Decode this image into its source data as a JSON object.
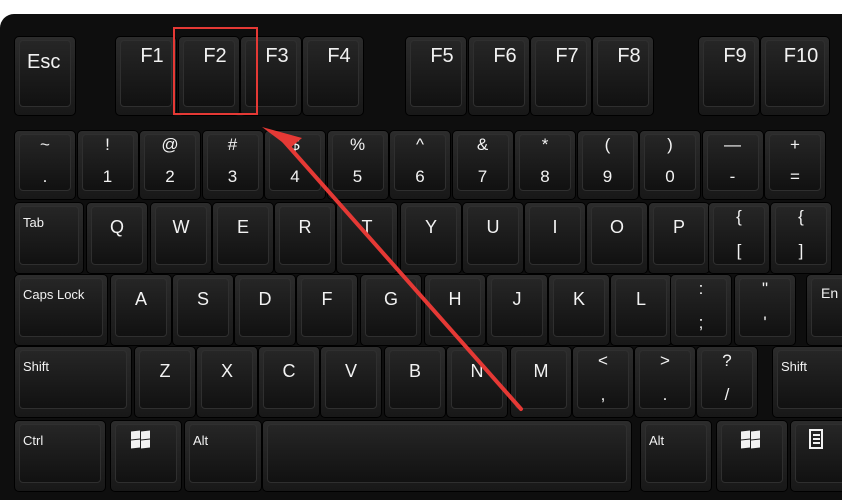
{
  "keyboard": {
    "function_row": [
      "Esc",
      "F1",
      "F2",
      "F3",
      "F4",
      "F5",
      "F6",
      "F7",
      "F8",
      "F9",
      "F10"
    ],
    "number_row": [
      {
        "top": "~",
        "bottom": "."
      },
      {
        "top": "!",
        "bottom": "1"
      },
      {
        "top": "@",
        "bottom": "2"
      },
      {
        "top": "#",
        "bottom": "3"
      },
      {
        "top": "$",
        "bottom": "4"
      },
      {
        "top": "%",
        "bottom": "5"
      },
      {
        "top": "^",
        "bottom": "6"
      },
      {
        "top": "&",
        "bottom": "7"
      },
      {
        "top": "*",
        "bottom": "8"
      },
      {
        "top": "(",
        "bottom": "9"
      },
      {
        "top": ")",
        "bottom": "0"
      },
      {
        "top": "—",
        "bottom": "-"
      },
      {
        "top": "+",
        "bottom": "="
      }
    ],
    "tab_row": [
      "Tab",
      "Q",
      "W",
      "E",
      "R",
      "T",
      "Y",
      "U",
      "I",
      "O",
      "P",
      {
        "top": "{",
        "bottom": "["
      },
      {
        "top": "{",
        "bottom": "]"
      }
    ],
    "caps_row": [
      "Caps Lock",
      "A",
      "S",
      "D",
      "F",
      "G",
      "H",
      "J",
      "K",
      "L",
      {
        "top": ":",
        "bottom": ";"
      },
      {
        "top": "\"",
        "bottom": "'"
      },
      "En"
    ],
    "shift_row": [
      "Shift",
      "Z",
      "X",
      "C",
      "V",
      "B",
      "N",
      "M",
      {
        "top": "<",
        "bottom": ","
      },
      {
        "top": ">",
        "bottom": "."
      },
      {
        "top": "?",
        "bottom": "/"
      },
      "Shift"
    ],
    "bottom_row": [
      "Ctrl",
      "Alt",
      "Alt"
    ],
    "icons": [
      "windows-icon",
      "windows-icon",
      "menu-icon"
    ]
  },
  "annotation": {
    "highlighted_key": "F2",
    "box_color": "#e53935",
    "arrow_color": "#e53935"
  }
}
